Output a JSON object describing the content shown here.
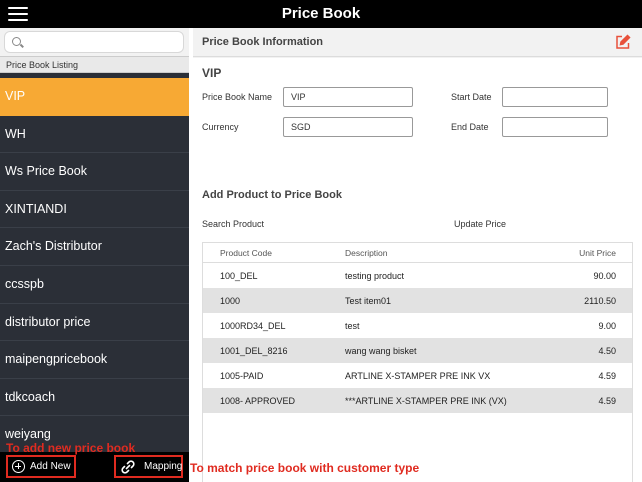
{
  "app": {
    "title": "Price Book"
  },
  "sidebar": {
    "search_placeholder": "",
    "listing_label": "Price Book Listing",
    "items": [
      {
        "label": "VIP",
        "active": true
      },
      {
        "label": "WH"
      },
      {
        "label": "Ws Price Book"
      },
      {
        "label": "XINTIANDI"
      },
      {
        "label": "Zach's Distributor"
      },
      {
        "label": "ccsspb"
      },
      {
        "label": "distributor price"
      },
      {
        "label": "maipengpricebook"
      },
      {
        "label": "tdkcoach"
      },
      {
        "label": "weiyang"
      }
    ],
    "add_new_label": "Add New",
    "mapping_label": "Mapping"
  },
  "annotations": {
    "add_new": "To add new price book",
    "mapping": "To match price book with customer type"
  },
  "main": {
    "header": "Price Book Information",
    "name_title": "VIP",
    "fields": {
      "price_book_name_label": "Price Book Name",
      "price_book_name_value": "VIP",
      "currency_label": "Currency",
      "currency_value": "SGD",
      "start_date_label": "Start Date",
      "start_date_value": "",
      "end_date_label": "End Date",
      "end_date_value": ""
    },
    "add_product_title": "Add Product to Price Book",
    "search_product_label": "Search Product",
    "update_price_label": "Update Price",
    "table": {
      "headers": {
        "code": "Product Code",
        "description": "Description",
        "price": "Unit Price"
      },
      "rows": [
        {
          "code": "100_DEL",
          "description": "testing product",
          "price": "90.00"
        },
        {
          "code": "1000",
          "description": "Test item01",
          "price": "2110.50"
        },
        {
          "code": "1000RD34_DEL",
          "description": "test",
          "price": "9.00"
        },
        {
          "code": "1001_DEL_8216",
          "description": "wang wang bisket",
          "price": "4.50"
        },
        {
          "code": "1005-PAID",
          "description": "ARTLINE X-STAMPER PRE INK VX",
          "price": "4.59"
        },
        {
          "code": "1008- APPROVED",
          "description": "***ARTLINE X-STAMPER PRE INK (VX)",
          "price": "4.59"
        }
      ]
    }
  },
  "colors": {
    "accent": "#f7a934",
    "sidebar_bg": "#2b2f37",
    "highlight": "#e02b20",
    "edit_icon": "#e8503a"
  }
}
